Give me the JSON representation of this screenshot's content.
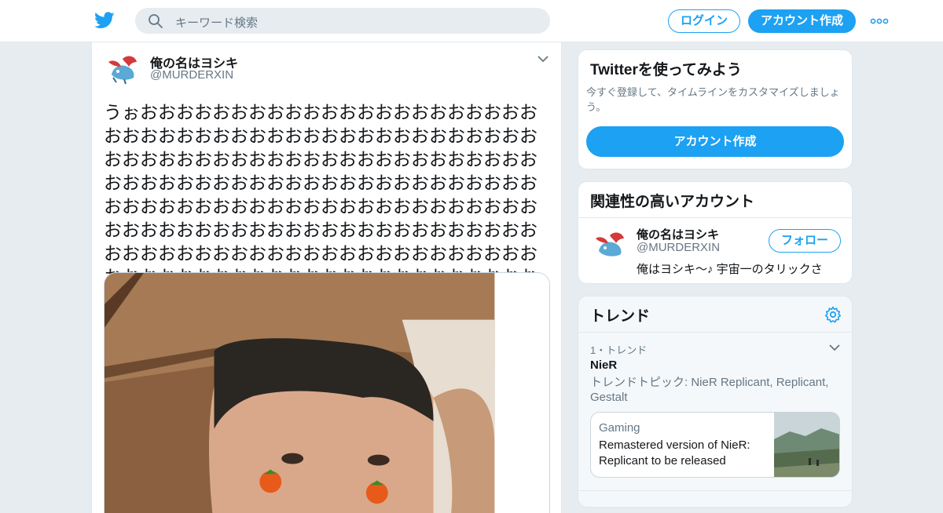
{
  "search": {
    "placeholder": "キーワード検索"
  },
  "header": {
    "login_label": "ログイン",
    "signup_label": "アカウント作成"
  },
  "tweet": {
    "name": "俺の名はヨシキ",
    "handle": "@MURDERXIN",
    "text": "うぉおおおおおおおおおおおおおおおおおおおおおおおおおおおおおおおおおおおおおおおおおおおおおおおおおおおおおおおおおおおおおおおおおおおおおおおおおおおおおおおおおおおおおおおおおおおおおおおおおおおおおおおおおおおおおおおおおおおおおおおおおおおおおおおおおおおおおおおおおおおおおおおおおおおおおおおおおおおおおおおおおおおおおおおおおおおおおおおおおおおおおおおおおおおおおおおおおおおおおおおおおおおおおおおおおお"
  },
  "signup_card": {
    "title": "Twitterを使ってみよう",
    "desc": "今すぐ登録して、タイムラインをカスタマイズしましょう。",
    "button": "アカウント作成"
  },
  "related_card": {
    "title": "関連性の高いアカウント",
    "name": "俺の名はヨシキ",
    "handle": "@MURDERXIN",
    "follow_label": "フォロー",
    "bio": "俺はヨシキ～♪ 宇宙一のタリックさ"
  },
  "trends_card": {
    "title": "トレンド",
    "rank": "1・トレンド",
    "topic": "NieR",
    "meta": "トレンドトピック: NieR Replicant, Replicant, Gestalt",
    "news": {
      "category": "Gaming",
      "title": "Remastered version of NieR: Replicant to be released"
    }
  },
  "colors": {
    "accent": "#1da1f2",
    "background": "#e6ecf0",
    "text": "#14171a",
    "secondary": "#657786"
  },
  "icons": {
    "logo": "twitter-bird-icon",
    "search": "search-icon",
    "more": "more-dots-icon",
    "settings": "gear-icon",
    "caret": "chevron-down-icon"
  }
}
